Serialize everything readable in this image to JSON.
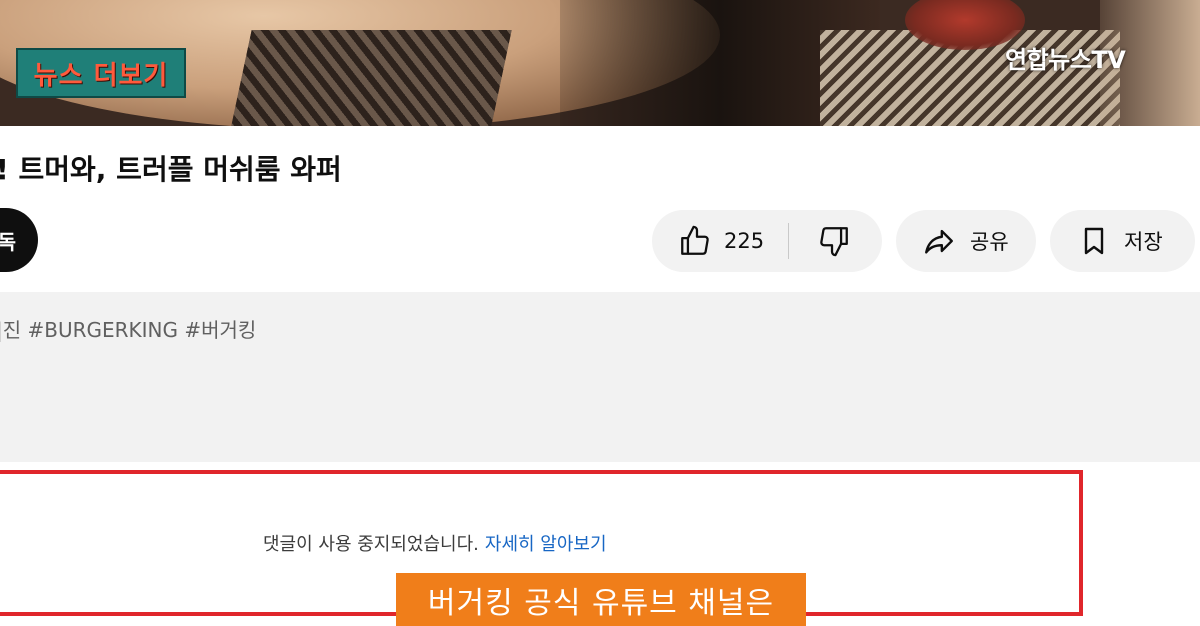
{
  "overlay": {
    "news_more_label": "뉴스 더보기",
    "broadcaster_logo": "연합뉴스TV"
  },
  "video": {
    "title": "! 트머와, 트러플 머쉬룸 와퍼"
  },
  "actions": {
    "subscribe_label": "독",
    "like_count": "225",
    "share_label": "공유",
    "save_label": "저장"
  },
  "description": {
    "hashtags": "|진 #BURGERKING #버거킹",
    "fragment": "|"
  },
  "comments": {
    "disabled_message": "댓글이 사용 중지되었습니다.",
    "learn_more_link": "자세히 알아보기"
  },
  "caption": {
    "text": "버거킹 공식 유튜브 채널은"
  },
  "colors": {
    "highlight_border": "#e0262b",
    "caption_bg": "#f07e1a",
    "news_more_bg": "#1f7f78",
    "news_more_text": "#ff5a3c",
    "link": "#1766c4"
  },
  "icons": {
    "like": "thumbs-up-icon",
    "dislike": "thumbs-down-icon",
    "share": "share-arrow-icon",
    "save": "bookmark-icon"
  }
}
